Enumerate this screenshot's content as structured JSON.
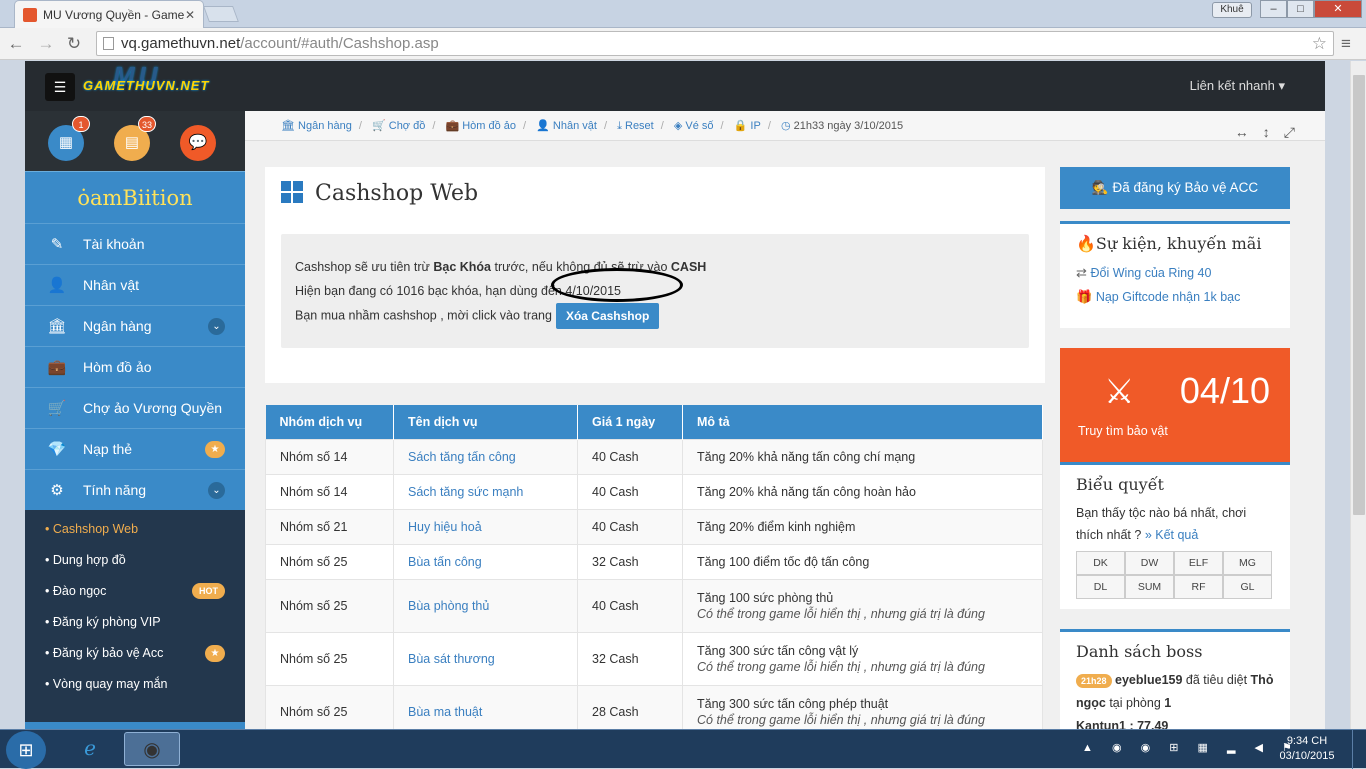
{
  "browser": {
    "tab_title": "MU Vương Quyền - Game",
    "tab_close": "✕",
    "user_chip": "Khuê",
    "url_host": "vq.gamethuvn.net",
    "url_path": "/account/#auth/Cashshop.asp",
    "min": "–",
    "max": "□",
    "close": "✕"
  },
  "navbar": {
    "logo_text": "GAMETHUVN.NET",
    "logo_mu": "MU",
    "quick_links": "Liên kết nhanh ▾"
  },
  "sidebar": {
    "badges": [
      "1",
      "33"
    ],
    "brand": "ȯamBiition",
    "items": [
      {
        "label": "Tài khoản",
        "icon": "✎"
      },
      {
        "label": "Nhân vật",
        "icon": "👤"
      },
      {
        "label": "Ngân hàng",
        "icon": "🏛"
      },
      {
        "label": "Hòm đồ ảo",
        "icon": "💼"
      },
      {
        "label": "Chợ ảo Vương Quyền",
        "icon": "🛒"
      },
      {
        "label": "Nạp thẻ",
        "icon": "💎"
      },
      {
        "label": "Tính năng",
        "icon": "⚙"
      }
    ],
    "chevron": "⌄",
    "star": "★",
    "sub_items": [
      "• Cashshop Web",
      "• Dung hợp đồ",
      "• Đào ngọc",
      "• Đăng ký phòng VIP",
      "• Đăng ký bảo vệ Acc",
      "• Vòng quay may mắn"
    ],
    "hot_badge": "HOT"
  },
  "breadcrumb": {
    "items": [
      "Ngân hàng",
      "Chợ đồ",
      "Hòm đồ ảo",
      "Nhân vật",
      "Reset",
      "Vé số",
      "IP"
    ],
    "sep": "/",
    "time": "21h33 ngày 3/10/2015",
    "tools": "↔↕⤢"
  },
  "cashshop": {
    "title": "Cashshop Web",
    "line1_a": "Cashshop sẽ ưu tiên trừ ",
    "line1_b": "Bạc Khóa",
    "line1_c": " trước, nếu không đủ sẽ trừ vào ",
    "line1_d": "CASH",
    "line2": "Hiện bạn đang có 1016 bạc khóa, hạn dùng đến 4/10/2015",
    "line3": "Bạn mua nhầm cashshop , mời click vào trang",
    "delete_button": "Xóa Cashshop"
  },
  "table": {
    "headers": [
      "Nhóm dịch vụ",
      "Tên dịch vụ",
      "Giá 1 ngày",
      "Mô tả"
    ],
    "rows": [
      {
        "group": "Nhóm số 14",
        "name": "Sách tăng tấn công",
        "price": "40 Cash",
        "desc": "Tăng 20% khả năng tấn công chí mạng",
        "note": ""
      },
      {
        "group": "Nhóm số 14",
        "name": "Sách tăng sức mạnh",
        "price": "40 Cash",
        "desc": "Tăng 20% khả năng tấn công hoàn hảo",
        "note": ""
      },
      {
        "group": "Nhóm số 21",
        "name": "Huy hiệu hoả",
        "price": "40 Cash",
        "desc": "Tăng 20% điểm kinh nghiệm",
        "note": ""
      },
      {
        "group": "Nhóm số 25",
        "name": "Bùa tấn công",
        "price": "32 Cash",
        "desc": "Tăng 100 điểm tốc độ tấn công",
        "note": ""
      },
      {
        "group": "Nhóm số 25",
        "name": "Bùa phòng thủ",
        "price": "40 Cash",
        "desc": "Tăng 100 sức phòng thủ",
        "note": "Có thể trong game lỗi hiển thị , nhưng giá trị là đúng"
      },
      {
        "group": "Nhóm số 25",
        "name": "Bùa sát thương",
        "price": "32 Cash",
        "desc": "Tăng 300 sức tấn công vật lý",
        "note": "Có thể trong game lỗi hiển thị , nhưng giá trị là đúng"
      },
      {
        "group": "Nhóm số 25",
        "name": "Bùa ma thuật",
        "price": "28 Cash",
        "desc": "Tăng 300 sức tấn công phép thuật",
        "note": "Có thể trong game lỗi hiển thị , nhưng giá trị là đúng"
      }
    ]
  },
  "right": {
    "register_button": "Đã đăng ký Bảo vệ ACC",
    "events_title": "Sự kiện, khuyến mãi",
    "events": [
      "Đổi Wing của Ring 40",
      "Nạp Giftcode nhận 1k bạc"
    ],
    "treasure_num": "04/10",
    "treasure_label": "Truy tìm bảo vật",
    "vote_title": "Biểu quyết",
    "vote_q_a": "Bạn thấy tộc nào bá nhất, chơi thích nhất ?",
    "vote_link": "» Kết quả",
    "races": [
      "DK",
      "DW",
      "ELF",
      "MG",
      "DL",
      "SUM",
      "RF",
      "GL"
    ],
    "boss_title": "Danh sách boss",
    "boss_level": "21h28",
    "boss_player": "eyeblue159",
    "boss_text1": " đã tiêu diệt ",
    "boss_name": "Thỏ ngọc",
    "boss_text2": " tại phòng ",
    "boss_room": "1",
    "boss_next": "Kantun1 : 77.49"
  },
  "taskbar": {
    "time": "9:34 CH",
    "date": "03/10/2015"
  }
}
